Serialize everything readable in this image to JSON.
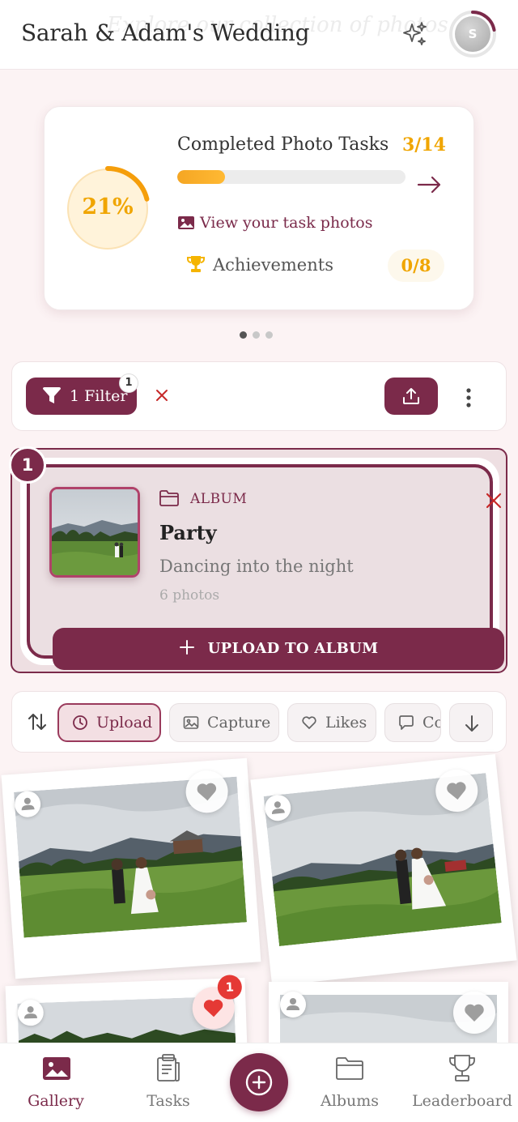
{
  "header": {
    "title": "Sarah & Adam's Wedding",
    "tagline": "Explore our collection of photos",
    "avatar_initial": "S",
    "avatar_progress": 0.22
  },
  "progress_card": {
    "percent_label": "21%",
    "percent": 0.21,
    "tasks_title": "Completed Photo Tasks",
    "tasks_count": "3/14",
    "tasks_progress": 0.21,
    "view_photos_link": "View your task photos",
    "achievements_label": "Achievements",
    "achievements_count": "0/8",
    "carousel_pages": 3,
    "carousel_active": 0
  },
  "filter_bar": {
    "filter_label": "1 Filter",
    "filter_badge": "1"
  },
  "album_filter": {
    "index": "1",
    "type_label": "ALBUM",
    "name": "Party",
    "description": "Dancing into the night",
    "photo_count": "6 photos",
    "upload_label": "UPLOAD TO ALBUM"
  },
  "sort_bar": {
    "chips": [
      {
        "label": "Upload",
        "icon": "clock-icon",
        "active": true
      },
      {
        "label": "Capture",
        "icon": "image-icon",
        "active": false
      },
      {
        "label": "Likes",
        "icon": "heart-icon",
        "active": false
      },
      {
        "label": "Comments",
        "icon": "comment-icon",
        "active": false
      }
    ]
  },
  "photos": [
    {
      "liked": false,
      "likes": ""
    },
    {
      "liked": false,
      "likes": ""
    },
    {
      "liked": true,
      "likes": "1"
    },
    {
      "liked": false,
      "likes": ""
    }
  ],
  "bottom_nav": {
    "items": [
      {
        "label": "Gallery",
        "icon": "gallery-icon",
        "active": true
      },
      {
        "label": "Tasks",
        "icon": "clipboard-icon",
        "active": false
      },
      {
        "label": "Albums",
        "icon": "folder-icon",
        "active": false
      },
      {
        "label": "Leaderboard",
        "icon": "trophy-icon",
        "active": false
      }
    ]
  },
  "colors": {
    "brand": "#7b2a4a",
    "accent": "#f0a500",
    "background": "#fcf3f4",
    "like_red": "#e53935"
  }
}
